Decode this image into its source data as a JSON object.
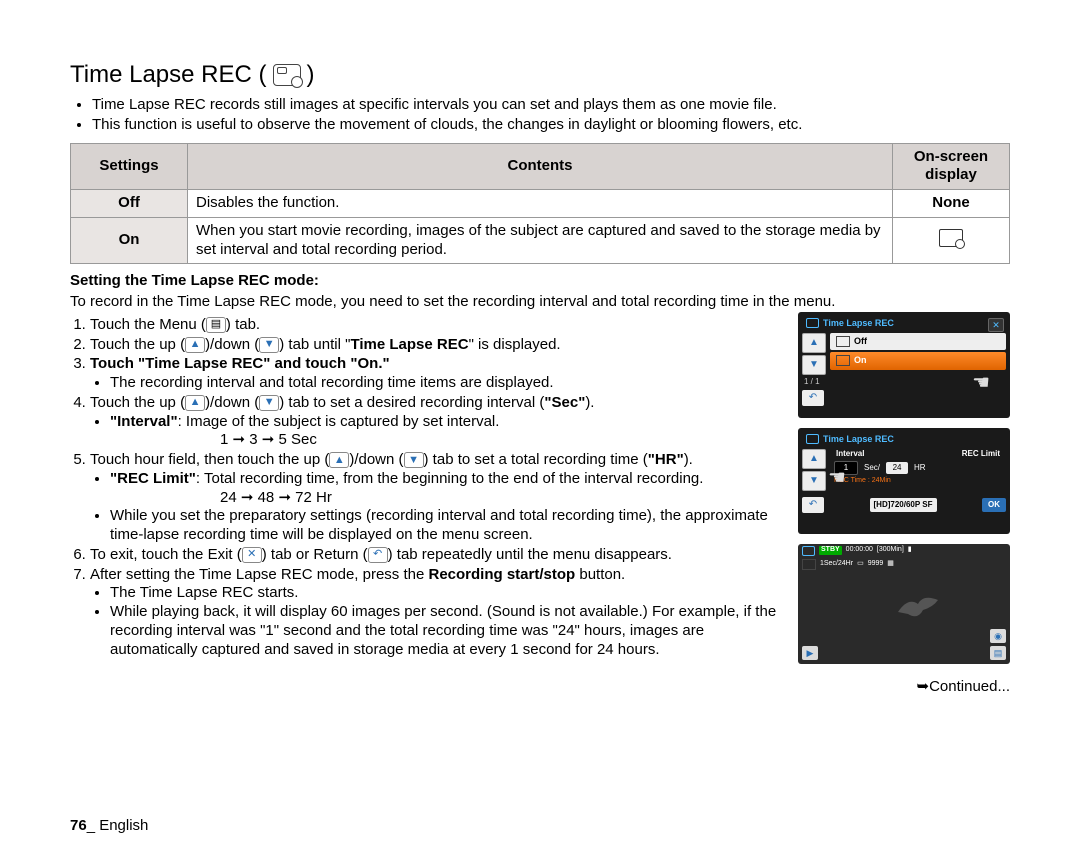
{
  "title": "Time Lapse REC (",
  "title_end": ")",
  "intro": [
    "Time Lapse REC records still images at specific intervals you can set and plays them as one movie file.",
    "This function is useful to observe the movement of clouds, the changes in daylight or blooming flowers, etc."
  ],
  "table": {
    "h1": "Settings",
    "h2": "Contents",
    "h3": "On-screen display",
    "r1c1": "Off",
    "r1c2": "Disables the function.",
    "r1c3": "None",
    "r2c1": "On",
    "r2c2": "When you start movie recording, images of the subject are captured and saved to the storage media by set interval and total recording period."
  },
  "subhead": "Setting the Time Lapse REC mode:",
  "subintro": "To record in the Time Lapse REC mode, you need to set the recording interval and total recording time in the menu.",
  "steps": {
    "s1a": "Touch the Menu (",
    "s1b": ") tab.",
    "s2a": "Touch the up (",
    "s2b": ")/down (",
    "s2c": ") tab until \"",
    "s2d": "Time Lapse REC",
    "s2e": "\" is displayed.",
    "s3a": "Touch \"",
    "s3b": "Time Lapse REC",
    "s3c": "\" and touch \"",
    "s3d": "On.",
    "s3e": "\"",
    "s3_bullet": "The recording interval and total recording time items are displayed.",
    "s4a": "Touch the up (",
    "s4b": ")/down (",
    "s4c": ") tab to set a desired recording interval (",
    "s4d": "\"Sec\"",
    "s4e": ").",
    "s4_bullet_a": "\"Interval\"",
    "s4_bullet_b": ": Image of the subject is captured by set interval.",
    "s4_seq": "1 ➞ 3 ➞ 5 Sec",
    "s5a": "Touch hour field, then touch the up (",
    "s5b": ")/down (",
    "s5c": ") tab to set a total recording time (",
    "s5d": "\"HR\"",
    "s5e": ").",
    "s5_bullet_a": "\"REC Limit\"",
    "s5_bullet_b": ": Total recording time, from the beginning to the end of the interval recording.",
    "s5_seq": "24 ➞ 48 ➞ 72 Hr",
    "s5_bullet2": "While you set the preparatory settings (recording interval and total recording time), the approximate time-lapse recording time will be displayed on the menu screen.",
    "s6a": "To exit, touch the Exit (",
    "s6b": ") tab or Return (",
    "s6c": ") tab repeatedly until the menu disappears.",
    "s7a": "After setting the Time Lapse REC mode, press the ",
    "s7b": "Recording start/stop",
    "s7c": " button.",
    "s7_bullet1": "The Time Lapse REC starts.",
    "s7_bullet2": "While playing back, it will display 60 images per second. (Sound is not available.) For example, if the recording interval was \"1\" second and the total recording time was \"24\" hours, images are automatically captured and saved in storage media at every 1 second for 24 hours."
  },
  "screens": {
    "title": "Time Lapse REC",
    "off": "Off",
    "on": "On",
    "pager": "1 / 1",
    "interval_label": "Interval",
    "reclimit_label": "REC Limit",
    "sec_val": "1",
    "sec_unit": "Sec/",
    "hr_val": "24",
    "hr_unit": "HR",
    "rectime": "REC Time : 24Min",
    "format": "[HD]720/60P SF",
    "ok": "OK",
    "stby": "STBY",
    "timecode": "00:00:00",
    "remain": "[300Min]",
    "osd_line2": "1Sec/24Hr",
    "osd_count": "9999"
  },
  "continued": "➥Continued...",
  "footer_page": "76",
  "footer_sep": "_ ",
  "footer_lang": "English"
}
